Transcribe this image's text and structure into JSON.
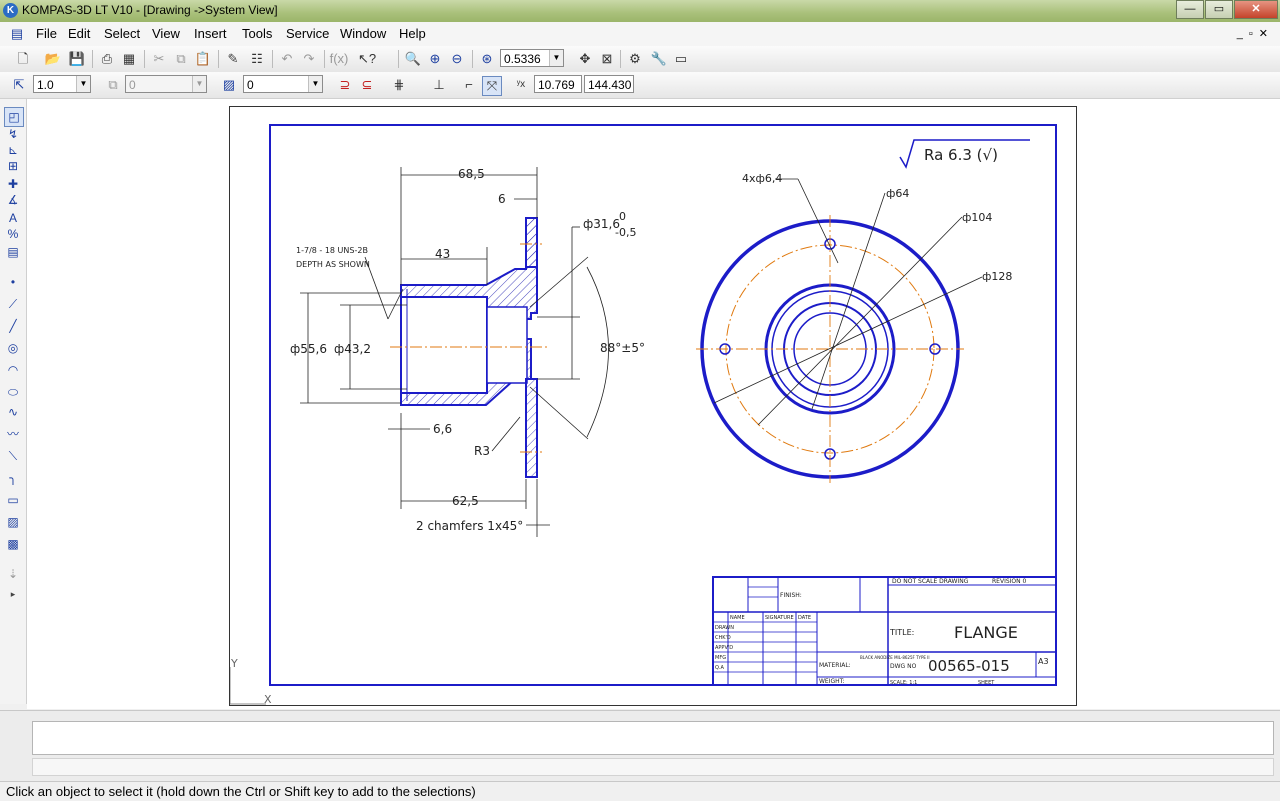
{
  "window": {
    "title": "KOMPAS-3D LT V10 - [Drawing ->System View]",
    "icon": "kompas-logo-icon"
  },
  "menu": [
    "File",
    "Edit",
    "Select",
    "View",
    "Insert",
    "Tools",
    "Service",
    "Window",
    "Help"
  ],
  "toolbar1": {
    "zoom_value": "0.5336"
  },
  "toolbar2": {
    "line_scale": "1.0",
    "layer_value": "0",
    "style_value": "0",
    "coord_x": "10.769",
    "coord_y": "144.430"
  },
  "drawing": {
    "roughness": "Ra 6.3 (√)",
    "dims": {
      "d68": "68,5",
      "d6": "6",
      "d43": "43",
      "d31": "ф31,6",
      "tol_up": "0",
      "tol_dn": "-0,5",
      "thread1": "1-7/8 - 18 UNS-2B",
      "thread2": "DEPTH AS SHOWN",
      "d55": "ф55,6",
      "d43_2": "ф43,2",
      "angle": "88°±5°",
      "d66": "6,6",
      "r3": "R3",
      "d62": "62,5",
      "chamfers": "2 chamfers 1x45°",
      "holes": "4xф6,4",
      "d64": "ф64",
      "d104": "ф104",
      "d128": "ф128"
    },
    "title_block": {
      "title_label": "TITLE:",
      "title": "FLANGE",
      "dwg_label": "DWG NO",
      "dwg_no": "00565-015",
      "size": "A3",
      "finish_label": "FINISH:",
      "material_label": "MATERIAL:",
      "weight_label": "WEIGHT:",
      "scale_label": "SCALE: 1:1",
      "sheet_label": "SHEET",
      "no_scale": "DO NOT SCALE DRAWING",
      "revision": "REVISION 0",
      "name": "NAME",
      "signature": "SIGNATURE",
      "date": "DATE",
      "rows": [
        "DRAWN",
        "CHK'D",
        "APPV'D",
        "MFG",
        "Q.A"
      ],
      "material_value": "BLACK ANODIZE MIL-8625F TYPE II"
    },
    "axis_y": "Y",
    "axis_x": "X"
  },
  "status": {
    "hint": "Click an object to select it (hold down the Ctrl or Shift key to add to the selections)"
  }
}
